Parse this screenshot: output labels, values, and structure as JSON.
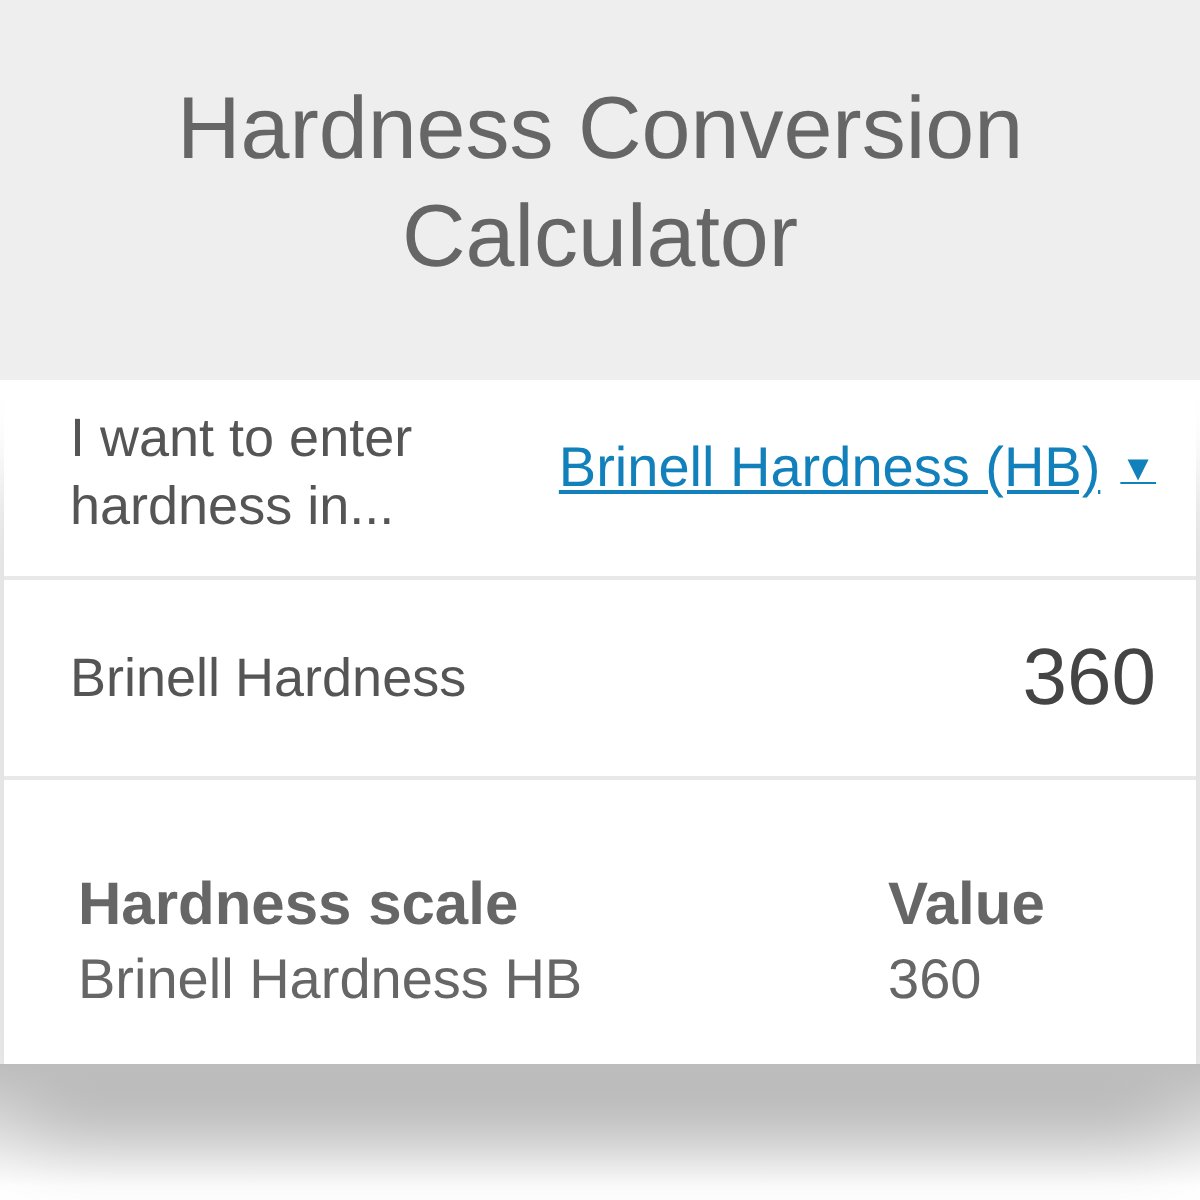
{
  "header": {
    "title": "Hardness Conversion Calculator"
  },
  "unit_select": {
    "label": "I want to enter hardness in...",
    "value": "Brinell Hardness (HB)",
    "caret": "▼"
  },
  "input": {
    "label": "Brinell Hardness",
    "value": "360"
  },
  "table": {
    "columns": [
      "Hardness scale",
      "Value"
    ],
    "rows": [
      [
        "Brinell Hardness HB",
        "360"
      ]
    ]
  }
}
